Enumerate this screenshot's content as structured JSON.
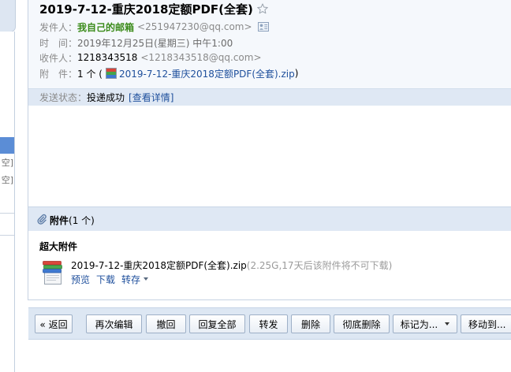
{
  "sidebar": {
    "items": [
      {
        "label": "空]"
      },
      {
        "label": "空]"
      }
    ]
  },
  "mail": {
    "subject": "2019-7-12-重庆2018定额PDF(全套)",
    "from": {
      "label": "发件人：",
      "name": "我自己的邮箱",
      "email": "<251947230@qq.com>"
    },
    "time": {
      "label": "时　间：",
      "value": "2019年12月25日(星期三) 中午1:00"
    },
    "to": {
      "label": "收件人：",
      "name": "1218343518",
      "email": "<1218343518@qq.com>"
    },
    "attachment": {
      "label": "附　件：",
      "count": "1 个 (",
      "file_link": "2019-7-12-重庆2018定额PDF(全套).zip",
      "close": ")"
    },
    "status": {
      "label": "发送状态：",
      "value": "投递成功",
      "details_link": "[查看详情]"
    }
  },
  "attachments": {
    "title": "附件",
    "count": "(1 个)",
    "section_label": "超大附件",
    "files": [
      {
        "name": "2019-7-12-重庆2018定额PDF(全套).zip",
        "info": "(2.25G,17天后该附件将不可下载)",
        "actions": {
          "preview": "预览",
          "download": "下载",
          "save": "转存"
        }
      }
    ]
  },
  "toolbar": {
    "back": "« 返回",
    "edit_again": "再次编辑",
    "recall": "撤回",
    "reply_all": "回复全部",
    "forward": "转发",
    "delete": "删除",
    "delete_permanently": "彻底删除",
    "mark_as": "标记为...",
    "move_to": "移动到..."
  },
  "icons": {
    "star": "star-outline-icon",
    "contact_card": "contact-card-icon",
    "attachment": "paperclip-icon",
    "archive": "zip-archive-icon",
    "dropdown": "caret-down-icon"
  },
  "colors": {
    "link": "#1e4f9c",
    "sender": "#3b8b1a",
    "status_bar": "#dfe8f4",
    "sidebar_selected": "#5b8dd6"
  }
}
